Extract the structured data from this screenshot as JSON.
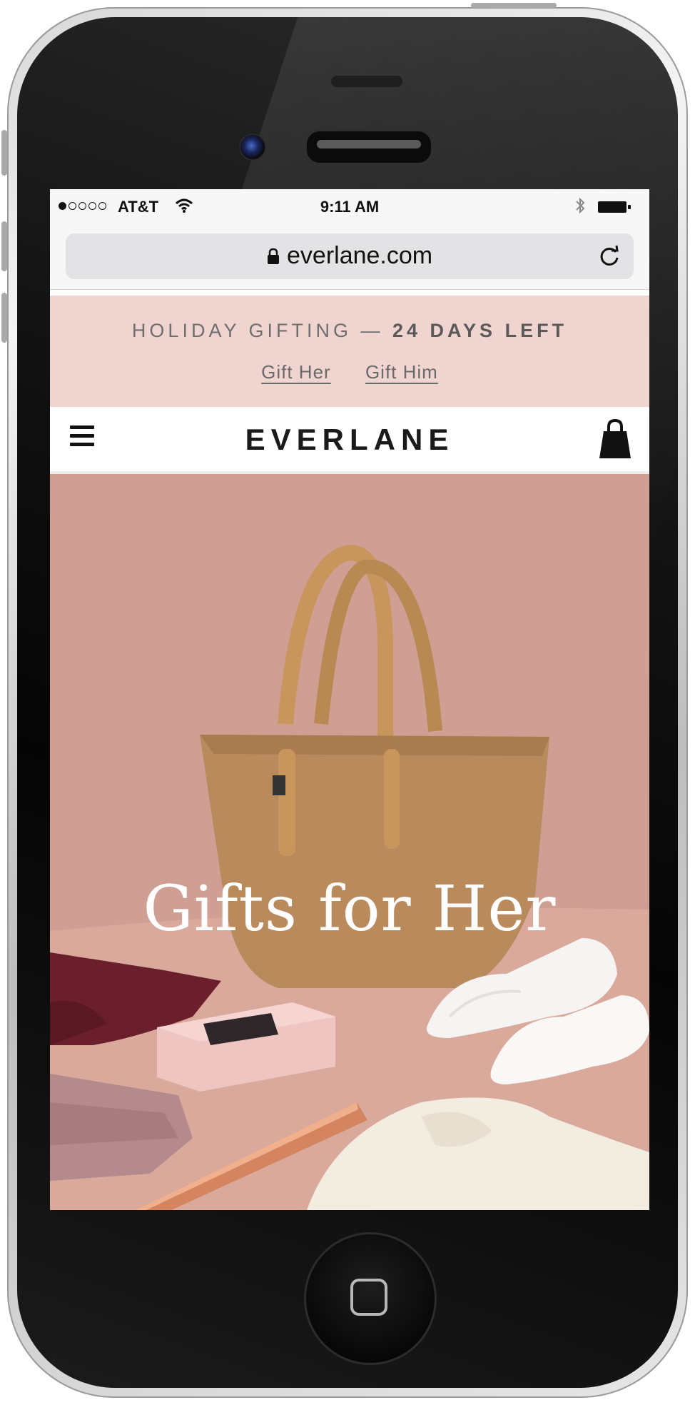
{
  "status_bar": {
    "carrier": "AT&T",
    "time": "9:11 AM"
  },
  "browser": {
    "url": "everlane.com"
  },
  "promo": {
    "text": "HOLIDAY GIFTING",
    "dash": "—",
    "countdown": "24 DAYS LEFT",
    "links": [
      "Gift Her",
      "Gift Him"
    ]
  },
  "nav": {
    "logo": "EVERLANE"
  },
  "hero": {
    "title": "Gifts for Her"
  },
  "colors": {
    "promo_bg": "#f0d4d0",
    "hero_bg": "#cf9f93"
  }
}
